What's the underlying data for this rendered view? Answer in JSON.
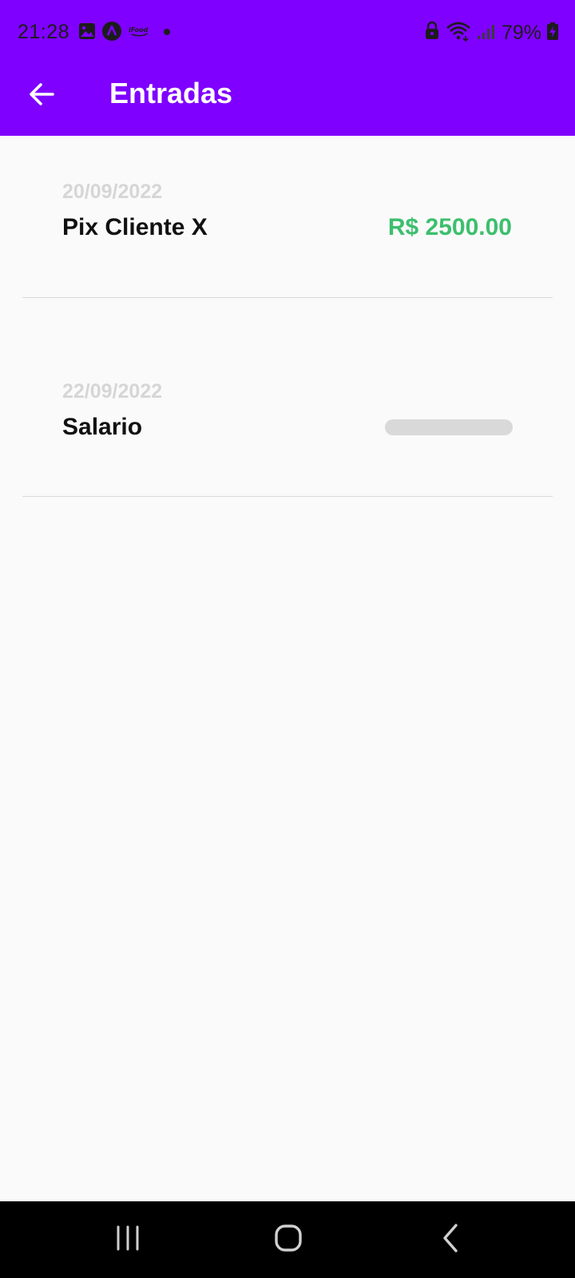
{
  "status_bar": {
    "time": "21:28",
    "battery_percent": "79%",
    "icons_left": [
      "gallery-icon",
      "app-a-icon",
      "ifood-icon",
      "notification-dot-icon"
    ],
    "icons_right": [
      "lock-icon",
      "wifi-icon",
      "signal-icon",
      "battery-charging-icon"
    ]
  },
  "app_bar": {
    "title": "Entradas",
    "back_icon": "arrow-left-icon",
    "background_color": "#7f00ff"
  },
  "entries": [
    {
      "date": "20/09/2022",
      "name": "Pix Cliente X",
      "amount": "R$ 2500.00",
      "amount_color": "#3dbf6e"
    },
    {
      "date": "22/09/2022",
      "name": "Salario",
      "amount": null,
      "amount_loading": true
    }
  ],
  "nav_bar": {
    "buttons": [
      "recent-apps-icon",
      "home-icon",
      "back-icon"
    ]
  }
}
